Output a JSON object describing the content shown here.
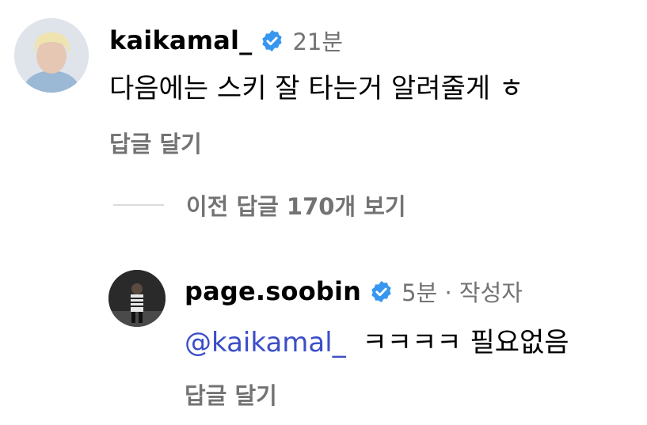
{
  "comment": {
    "username": "kaikamal_",
    "time": "21분",
    "text": "다음에는 스키 잘 타는거 알려줄게 ㅎ",
    "reply_label": "답글 달기"
  },
  "view_previous": {
    "label": "이전 답글 170개 보기"
  },
  "reply": {
    "username": "page.soobin",
    "time": "5분 · 작성자",
    "mention": "@kaikamal_",
    "text": "ㅋㅋㅋㅋ 필요없음",
    "reply_label": "답글 달기"
  },
  "colors": {
    "verified_badge": "#3797f0",
    "mention": "#3b4ec7",
    "secondary_text": "#737373"
  }
}
